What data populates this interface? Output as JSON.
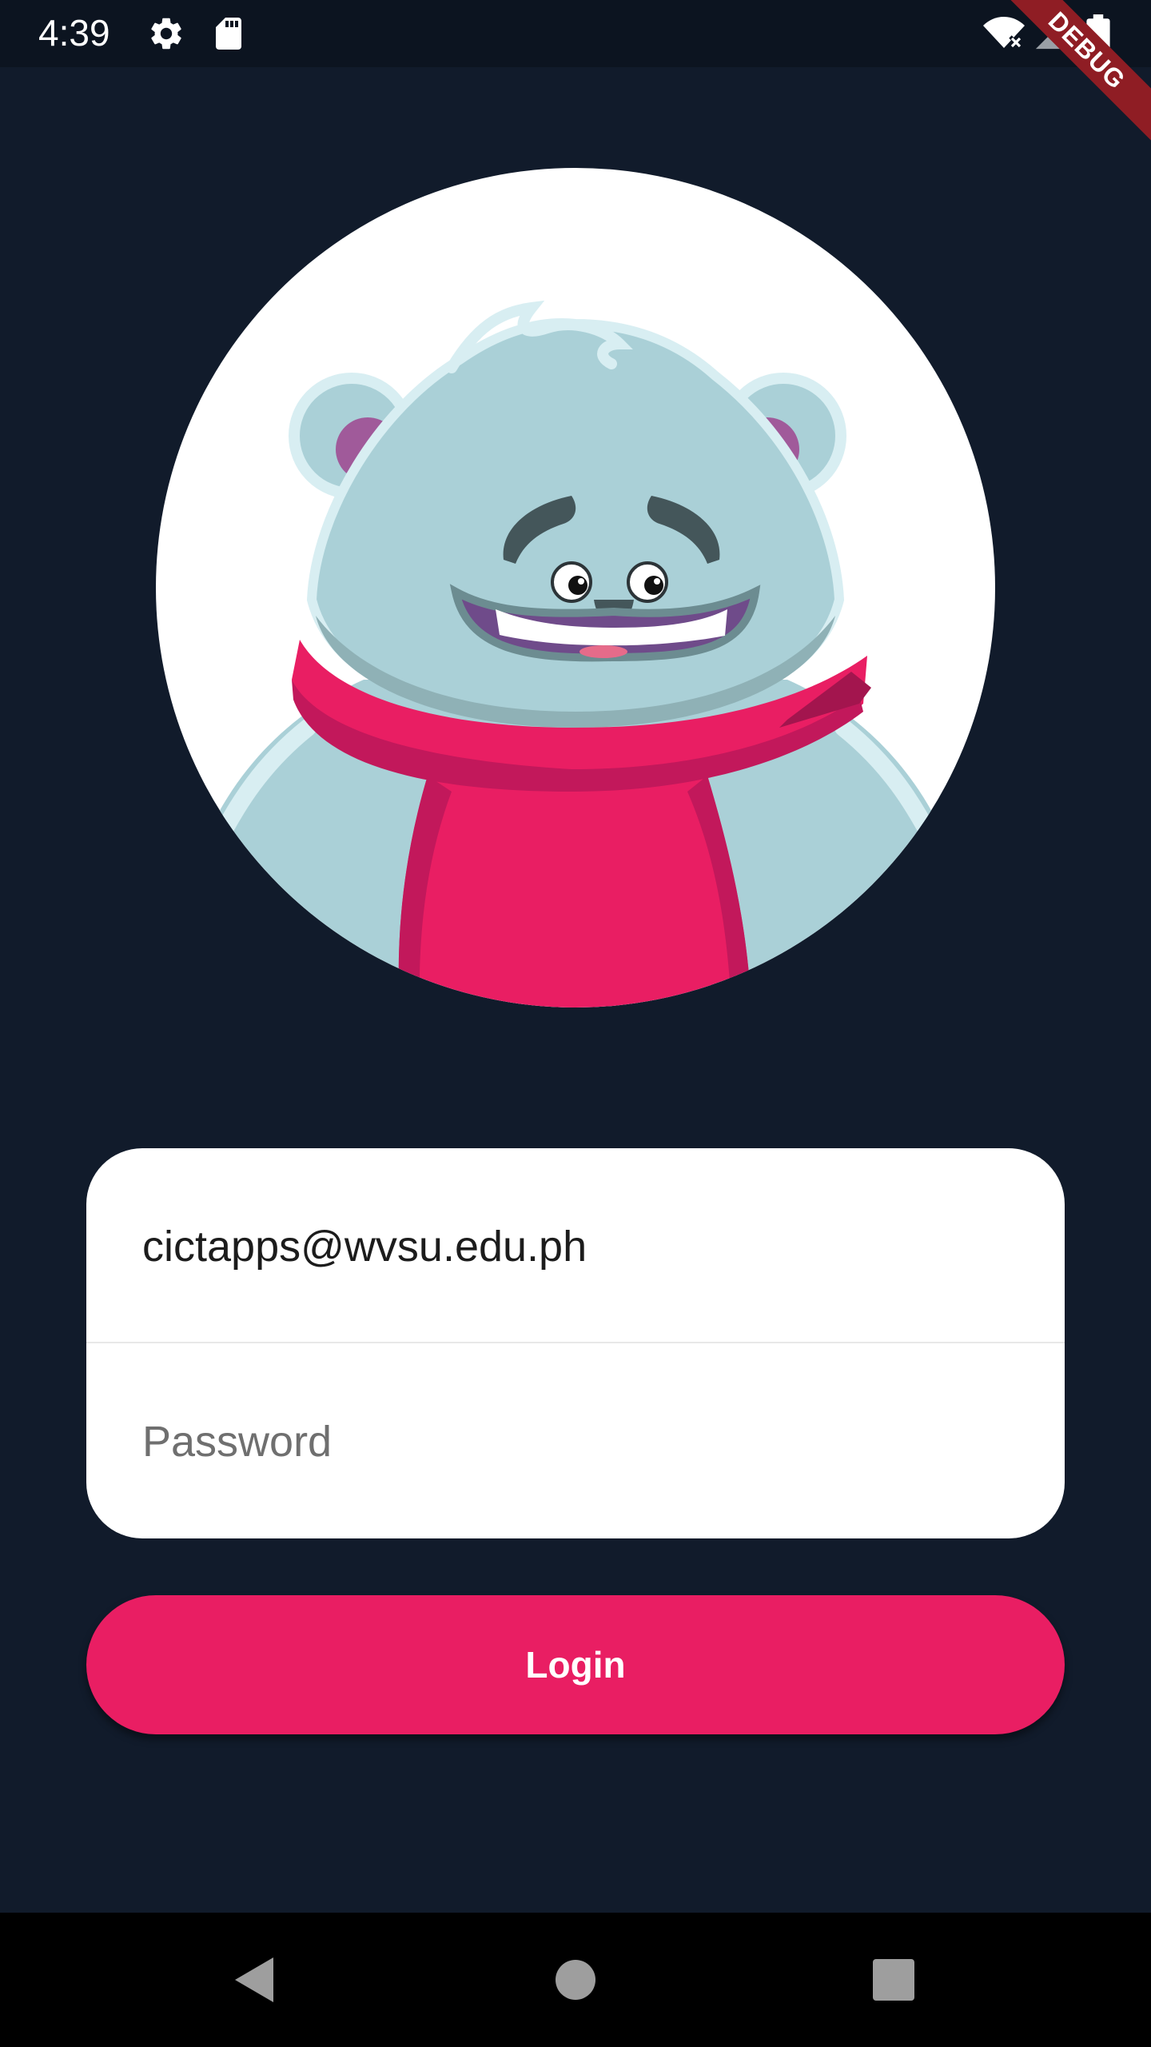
{
  "status_bar": {
    "time": "4:39",
    "icons": [
      "settings-icon",
      "sd-card-icon",
      "wifi-off-icon",
      "signal-icon",
      "battery-icon"
    ]
  },
  "debug_banner": {
    "label": "DEBUG"
  },
  "avatar": {
    "description_icon": "polar-bear-with-scarf-icon"
  },
  "login_form": {
    "email_value": "cictapps@wvsu.edu.ph",
    "password_placeholder": "Password"
  },
  "login_button": {
    "label": "Login"
  },
  "colors": {
    "background": "#111b2b",
    "accent": "#e91e63",
    "card": "#ffffff"
  },
  "nav_bar": {
    "icons": [
      "back-icon",
      "home-icon",
      "recents-icon"
    ]
  }
}
